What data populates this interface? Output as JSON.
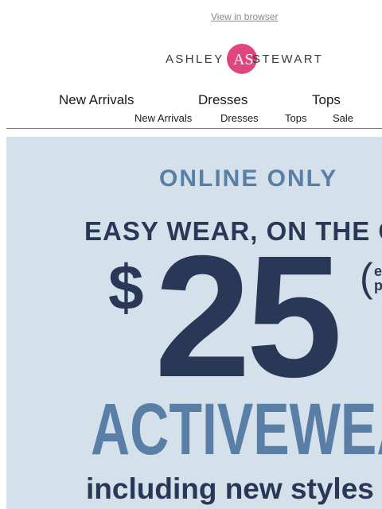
{
  "header": {
    "view_in_browser": "View in browser",
    "brand_left": "ASHLEY",
    "brand_right": "STEWART",
    "brand_mark_letters": "AS",
    "brand_color": "#e0457f"
  },
  "nav_primary": {
    "items": [
      {
        "label": "New Arrivals"
      },
      {
        "label": "Dresses"
      },
      {
        "label": "Tops"
      }
    ]
  },
  "nav_secondary": {
    "items": [
      {
        "label": "New Arrivals"
      },
      {
        "label": "Dresses"
      },
      {
        "label": "Tops"
      },
      {
        "label": "Sale"
      }
    ]
  },
  "hero": {
    "background": "#d5e1ea",
    "online_only": "ONLINE ONLY",
    "headline": "EASY WEAR, ON THE G",
    "dollar_sign": "$",
    "price": "25",
    "fine_print_line1": "e",
    "fine_print_line2": "p",
    "category": "ACTIVEWEAR",
    "subline": "including new styles",
    "navy": "#283856",
    "blue": "#5a7fa6"
  }
}
